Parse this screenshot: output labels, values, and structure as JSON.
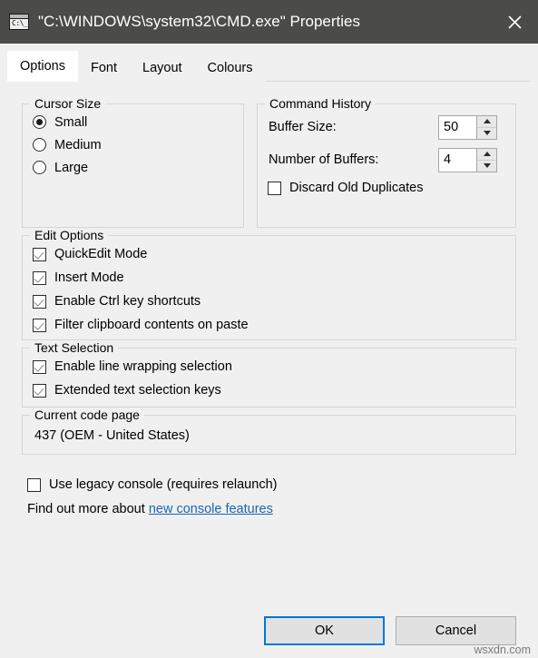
{
  "window": {
    "title": "\"C:\\WINDOWS\\system32\\CMD.exe\" Properties",
    "icon_name": "cmd-console-icon",
    "icon_text": "C:\\_",
    "close_label": "✕",
    "titlebar_color": "#4b4b49",
    "accent_color": "#0078d7"
  },
  "tabs": [
    {
      "label": "Options",
      "active": true
    },
    {
      "label": "Font",
      "active": false
    },
    {
      "label": "Layout",
      "active": false
    },
    {
      "label": "Colours",
      "active": false
    }
  ],
  "cursor_size": {
    "legend": "Cursor Size",
    "options": [
      {
        "label": "Small",
        "checked": true
      },
      {
        "label": "Medium",
        "checked": false
      },
      {
        "label": "Large",
        "checked": false
      }
    ]
  },
  "command_history": {
    "legend": "Command History",
    "buffer_size": {
      "label": "Buffer Size:",
      "value": "50"
    },
    "number_of_buffers": {
      "label": "Number of Buffers:",
      "value": "4"
    },
    "discard_old_duplicates": {
      "label": "Discard Old Duplicates",
      "checked": false
    }
  },
  "edit_options": {
    "legend": "Edit Options",
    "items": [
      {
        "label": "QuickEdit Mode",
        "checked": true
      },
      {
        "label": "Insert Mode",
        "checked": true
      },
      {
        "label": "Enable Ctrl key shortcuts",
        "checked": true
      },
      {
        "label": "Filter clipboard contents on paste",
        "checked": true
      }
    ]
  },
  "text_selection": {
    "legend": "Text Selection",
    "items": [
      {
        "label": "Enable line wrapping selection",
        "checked": true
      },
      {
        "label": "Extended text selection keys",
        "checked": true
      }
    ]
  },
  "code_page": {
    "legend": "Current code page",
    "value": "437   (OEM - United States)"
  },
  "legacy": {
    "checkbox_label": "Use legacy console (requires relaunch)",
    "checked": false,
    "find_out_prefix": "Find out more about ",
    "link_text": "new console features",
    "link_color": "#1966b3"
  },
  "footer": {
    "ok_label": "OK",
    "cancel_label": "Cancel"
  },
  "watermark": "wsxdn.com"
}
